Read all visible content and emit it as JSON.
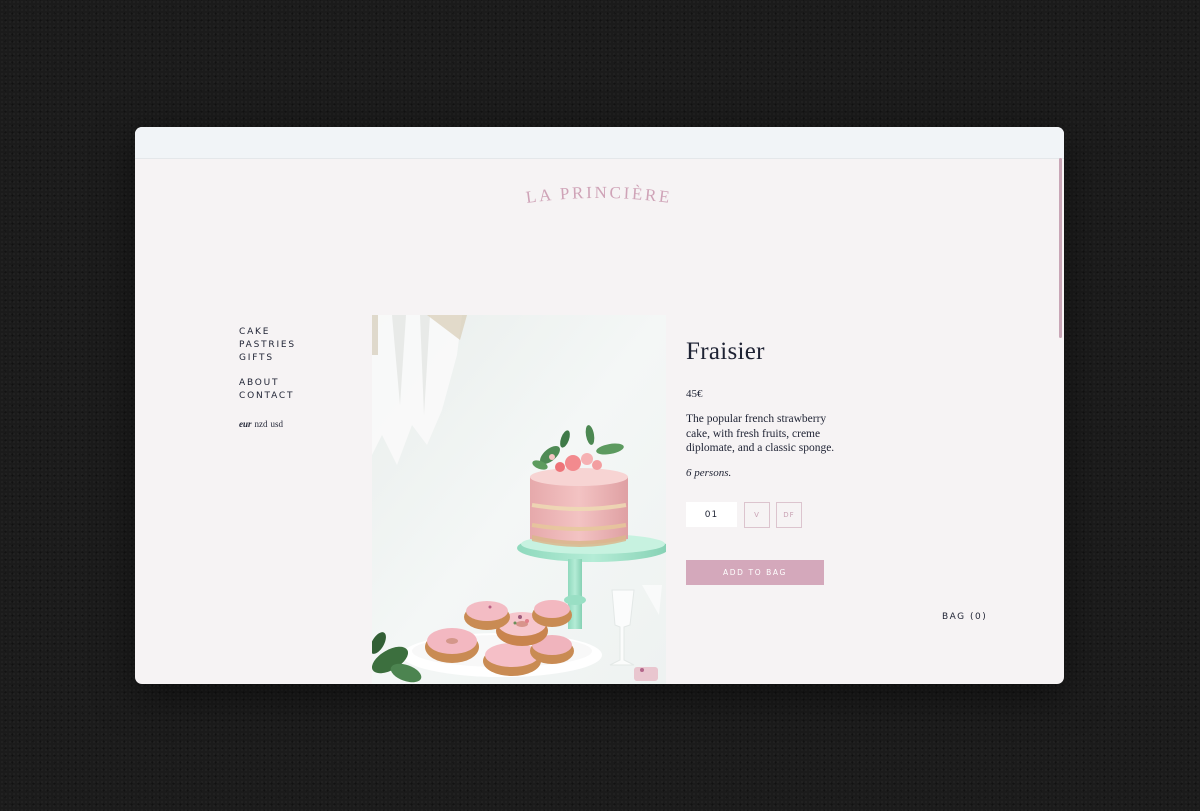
{
  "brand": {
    "logo_text": "LA PRINCIÈRE",
    "accent_color": "#d4a8bb",
    "background_color": "#f6f3f4"
  },
  "nav": {
    "shop_items": [
      "CAKE",
      "PASTRIES",
      "GIFTS"
    ],
    "info_items": [
      "ABOUT",
      "CONTACT"
    ],
    "currencies": [
      "eur",
      "nzd",
      "usd"
    ],
    "active_currency": "eur"
  },
  "product": {
    "title": "Fraisier",
    "price": "45€",
    "description": "The popular french strawberry cake, with fresh fruits, creme diplomate, and a classic sponge.",
    "serves": "6 persons.",
    "quantity": "01",
    "options": [
      "V",
      "DF"
    ],
    "add_to_bag_label": "ADD TO BAG",
    "image_icon": "cake-photo"
  },
  "bag": {
    "label": "BAG (0)"
  }
}
